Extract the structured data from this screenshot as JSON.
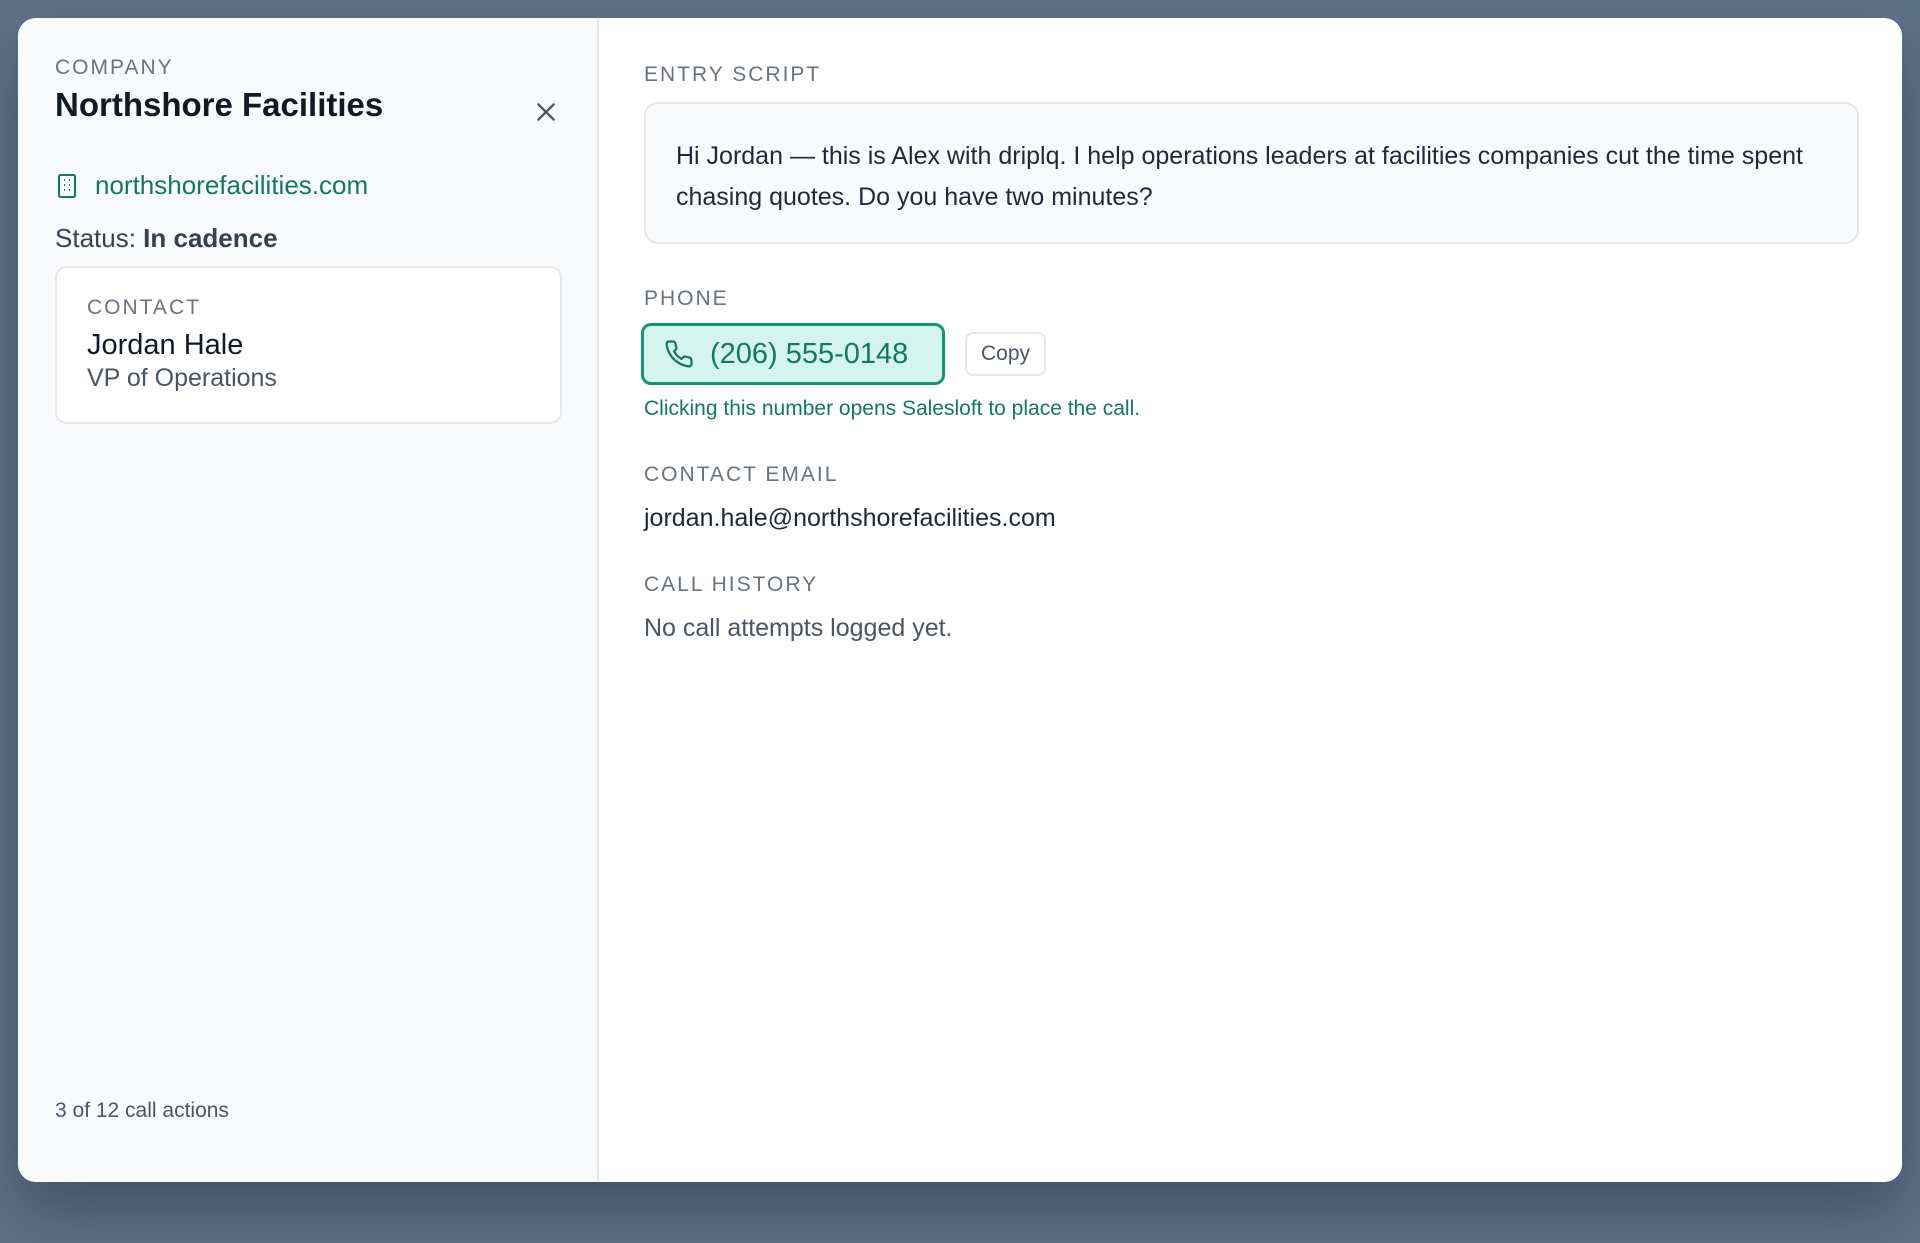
{
  "company": {
    "eyebrow": "COMPANY",
    "name": "Northshore Facilities",
    "website": "northshorefacilities.com",
    "status_label": "Status:",
    "status_value": "In cadence"
  },
  "contact": {
    "eyebrow": "CONTACT",
    "name": "Jordan Hale",
    "title": "VP of Operations"
  },
  "progress": {
    "text": "3 of 12 call actions"
  },
  "entry_script": {
    "label": "ENTRY SCRIPT",
    "text": "Hi Jordan — this is Alex with driplq. I help operations leaders at facilities companies cut the time spent chasing quotes. Do you have two minutes?"
  },
  "phone": {
    "label": "PHONE",
    "number": "(206) 555-0148",
    "copy_label": "Copy",
    "hint": "Clicking this number opens Salesloft to place the call."
  },
  "email": {
    "label": "CONTACT EMAIL",
    "value": "jordan.hale@northshorefacilities.com"
  },
  "call_history": {
    "label": "CALL HISTORY",
    "empty_text": "No call attempts logged yet."
  },
  "icons": {
    "close": "close-icon",
    "building": "building-icon",
    "phone": "phone-icon"
  },
  "colors": {
    "accent": "#0f7a63",
    "accent_border": "#139678",
    "accent_bg": "#d5f5ec",
    "backdrop": "#5f7188"
  }
}
